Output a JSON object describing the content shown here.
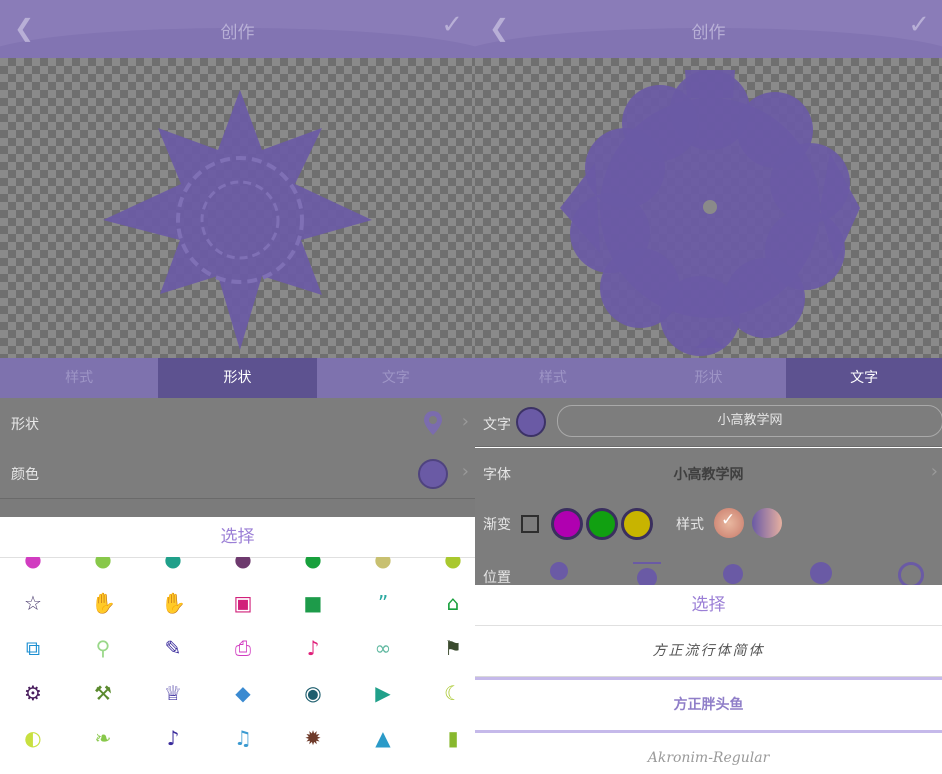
{
  "left": {
    "header": {
      "title": "创作",
      "back_icon": "chevron-left-icon",
      "confirm_icon": "checkmark-icon"
    },
    "tabs": [
      {
        "label": "样式"
      },
      {
        "label": "形状"
      },
      {
        "label": "文字"
      }
    ],
    "active_tab": "形状",
    "settings": {
      "shape": {
        "label": "形状",
        "value_icon": "map-pin-icon"
      },
      "color": {
        "label": "颜色"
      }
    },
    "picker": {
      "title": "选择",
      "icons": [
        "star-outline-icon",
        "thumbs-up-icon",
        "thumbs-down-icon",
        "chat-bubbles-icon",
        "comment-icon",
        "quote-icon",
        "home-icon",
        "copy-icon",
        "search-icon",
        "flashlight-icon",
        "print-icon",
        "bell-icon",
        "link-icon",
        "flag-icon",
        "gear-icon",
        "tools-icon",
        "trophy-icon",
        "tag-icon",
        "camera-icon",
        "megaphone-icon",
        "moon-icon",
        "palette-icon",
        "leaf-icon",
        "music-note-icon",
        "music-notes-icon",
        "alert-badge-icon",
        "graduation-cap-icon",
        "book-icon"
      ],
      "colors": {
        "star-outline-icon": "#4a3a6e",
        "thumbs-up-icon": "#3b2c9c",
        "thumbs-down-icon": "#3b2c9c",
        "chat-bubbles-icon": "#d1207a",
        "comment-icon": "#1d9b4a",
        "quote-icon": "#2aa9a0",
        "home-icon": "#18a03c",
        "copy-icon": "#1d8fd1",
        "search-icon": "#9ad88a",
        "flashlight-icon": "#3b2c9c",
        "print-icon": "#d13cc0",
        "bell-icon": "#e0207a",
        "link-icon": "#5fb8a0",
        "flag-icon": "#3a4a2e",
        "gear-icon": "#4a1e5e",
        "tools-icon": "#5a8a2e",
        "trophy-icon": "#3b2c9c",
        "tag-icon": "#3a8ad1",
        "camera-icon": "#1e5e6e",
        "megaphone-icon": "#20a08a",
        "moon-icon": "#a9c82e",
        "palette-icon": "#c8e040",
        "leaf-icon": "#88c84a",
        "music-note-icon": "#3b2c9c",
        "music-notes-icon": "#3a9ad1",
        "alert-badge-icon": "#6e3a2a",
        "graduation-cap-icon": "#2a9ac8",
        "book-icon": "#88b82e"
      }
    }
  },
  "right": {
    "header": {
      "title": "创作",
      "back_icon": "chevron-left-icon",
      "confirm_icon": "checkmark-icon"
    },
    "tabs": [
      {
        "label": "样式"
      },
      {
        "label": "形状"
      },
      {
        "label": "文字"
      }
    ],
    "active_tab": "文字",
    "settings": {
      "text": {
        "label": "文字",
        "value": "小高教学网"
      },
      "font": {
        "label": "字体",
        "value": "小高教学网"
      },
      "gradient": {
        "label": "渐变",
        "colors": [
          "#b000b0",
          "#11a011",
          "#c8b400"
        ]
      },
      "style": {
        "label": "样式"
      },
      "position": {
        "label": "位置"
      }
    },
    "picker": {
      "title": "选择",
      "fonts": [
        "方正流行体简体",
        "方正胖头鱼",
        "Akronim-Regular"
      ],
      "selected_font": "方正胖头鱼"
    }
  },
  "colors": {
    "accent": "#9b7fd6",
    "shape_fill": "#6a5aa5",
    "tab_active": "#5d5290"
  }
}
